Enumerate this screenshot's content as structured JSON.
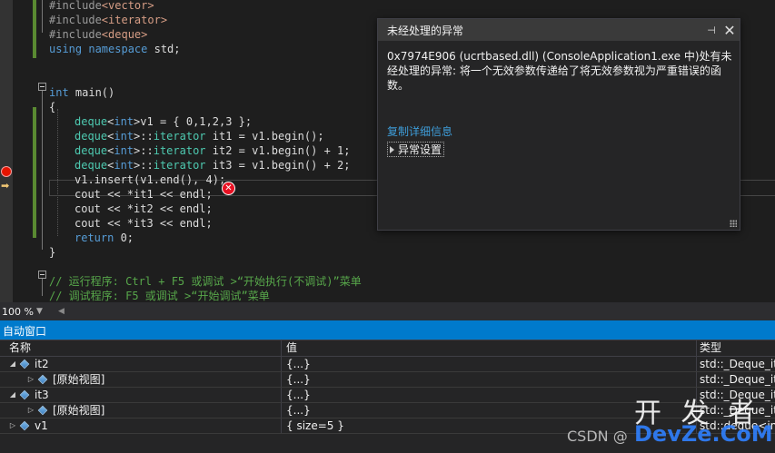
{
  "editor": {
    "lines": [
      {
        "parts": [
          {
            "c": "pre",
            "t": "#include"
          },
          {
            "c": "inc",
            "t": "<vector>"
          }
        ]
      },
      {
        "parts": [
          {
            "c": "pre",
            "t": "#include"
          },
          {
            "c": "inc",
            "t": "<iterator>"
          }
        ]
      },
      {
        "parts": [
          {
            "c": "pre",
            "t": "#include"
          },
          {
            "c": "inc",
            "t": "<deque>"
          }
        ]
      },
      {
        "parts": [
          {
            "c": "kw",
            "t": "using namespace "
          },
          {
            "c": "txt",
            "t": "std;"
          }
        ]
      },
      {
        "parts": []
      },
      {
        "parts": []
      },
      {
        "parts": [
          {
            "c": "kw",
            "t": "int "
          },
          {
            "c": "txt",
            "t": "main()"
          }
        ]
      },
      {
        "parts": [
          {
            "c": "txt",
            "t": "{"
          }
        ]
      },
      {
        "parts": [
          {
            "c": "ty",
            "t": "deque"
          },
          {
            "c": "txt",
            "t": "<"
          },
          {
            "c": "kw",
            "t": "int"
          },
          {
            "c": "txt",
            "t": ">v1 = { 0,1,2,3 };"
          }
        ]
      },
      {
        "parts": [
          {
            "c": "ty",
            "t": "deque"
          },
          {
            "c": "txt",
            "t": "<"
          },
          {
            "c": "kw",
            "t": "int"
          },
          {
            "c": "txt",
            "t": ">::"
          },
          {
            "c": "ty",
            "t": "iterator"
          },
          {
            "c": "txt",
            "t": " it1 = v1.begin();"
          }
        ]
      },
      {
        "parts": [
          {
            "c": "ty",
            "t": "deque"
          },
          {
            "c": "txt",
            "t": "<"
          },
          {
            "c": "kw",
            "t": "int"
          },
          {
            "c": "txt",
            "t": ">::"
          },
          {
            "c": "ty",
            "t": "iterator"
          },
          {
            "c": "txt",
            "t": " it2 = v1.begin() + 1;"
          }
        ]
      },
      {
        "parts": [
          {
            "c": "ty",
            "t": "deque"
          },
          {
            "c": "txt",
            "t": "<"
          },
          {
            "c": "kw",
            "t": "int"
          },
          {
            "c": "txt",
            "t": ">::"
          },
          {
            "c": "ty",
            "t": "iterator"
          },
          {
            "c": "txt",
            "t": " it3 = v1.begin() + 2;"
          }
        ]
      },
      {
        "parts": [
          {
            "c": "txt",
            "t": "v1.insert(v1.end(), 4);"
          }
        ]
      },
      {
        "parts": [
          {
            "c": "txt",
            "t": "cout << *it1 << endl;"
          }
        ]
      },
      {
        "parts": [
          {
            "c": "txt",
            "t": "cout << *it2 << endl;"
          }
        ]
      },
      {
        "parts": [
          {
            "c": "txt",
            "t": "cout << *it3 << endl;"
          }
        ]
      },
      {
        "parts": [
          {
            "c": "kw",
            "t": "return "
          },
          {
            "c": "txt",
            "t": "0;"
          }
        ]
      },
      {
        "parts": [
          {
            "c": "txt",
            "t": "}"
          }
        ]
      },
      {
        "parts": []
      },
      {
        "parts": [
          {
            "c": "cm",
            "t": "// 运行程序: Ctrl + F5 或调试 >“开始执行(不调试)”菜单"
          }
        ]
      },
      {
        "parts": [
          {
            "c": "cm",
            "t": "// 调试程序: F5 或调试 >“开始调试”菜单"
          }
        ]
      }
    ]
  },
  "exception": {
    "title": "未经处理的异常",
    "pin_glyph": "⊣",
    "close_glyph": "✕",
    "message": "0x7974E906 (ucrtbased.dll) (ConsoleApplication1.exe 中)处有未经处理的异常: 将一个无效参数传递给了将无效参数视为严重错误的函数。",
    "copy_link": "复制详细信息",
    "settings": "异常设置"
  },
  "zoom": {
    "value": "100 %",
    "dropdown_glyph": "▼",
    "scroll_left_glyph": "◀"
  },
  "error_glyph": "✕",
  "autos": {
    "title": "自动窗口",
    "columns": {
      "name": "名称",
      "value": "值",
      "type": "类型"
    },
    "rows": [
      {
        "name": "it2",
        "value": "{...}",
        "type": "std::_Deque_iterator<std::_Deque_val<std::_Deque_simple_types<int>>>",
        "expanded": true,
        "level": 0
      },
      {
        "name": "[原始视图]",
        "value": "{...}",
        "type": "std::_Deque_iterator<std::_Deque_val<std::_Deque_simple_types<int>>>",
        "expanded": false,
        "level": 1
      },
      {
        "name": "it3",
        "value": "{...}",
        "type": "std::_Deque_iterator<std::_Deque_val<std::_Deque_simple_types<int>>>",
        "expanded": true,
        "level": 0
      },
      {
        "name": "[原始视图]",
        "value": "{...}",
        "type": "std::_Deque_iterator<std::_Deque_val<std::_Deque_simple_types<int>>>",
        "expanded": false,
        "level": 1
      },
      {
        "name": "v1",
        "value": "{ size=5 }",
        "type": "std::deque<int,std::allocator<int>>",
        "expanded": false,
        "level": 0
      }
    ]
  },
  "watermark": {
    "csdn": "CSDN @",
    "logo_top": "开 发 者",
    "logo_bottom": "DevZe.CoM"
  }
}
